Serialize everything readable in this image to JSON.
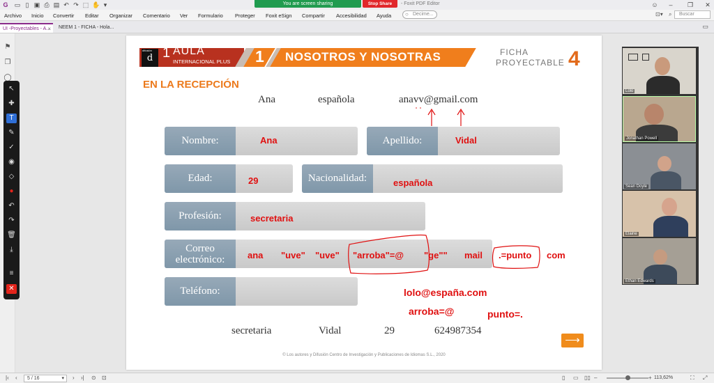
{
  "window": {
    "share_banner": "You are screen sharing",
    "stop_share": "Stop Share",
    "app_title": "- Foxit PDF Editor"
  },
  "menu": {
    "items": [
      "Archivo",
      "Inicio",
      "Convertir",
      "Editar",
      "Organizar",
      "Comentario",
      "Ver",
      "Formulario",
      "Proteger",
      "Foxit eSign",
      "Compartir",
      "Accesibilidad",
      "Ayuda"
    ],
    "help_search_placeholder": "Decime...",
    "doc_search_placeholder": "Buscar"
  },
  "tabs": [
    {
      "label": "UI -Proyectables - A...",
      "active": true
    },
    {
      "label": "NEEM 1 - FICHA - Hola...",
      "active": false
    }
  ],
  "document": {
    "logo": {
      "badge": "d",
      "number": "1",
      "title": "AULA",
      "subtitle": "INTERNACIONAL PLUS",
      "tiny": "difusión"
    },
    "unit_number": "1",
    "unit_title": "NOSOTROS Y NOSOTRAS",
    "ficha_label_1": "FICHA",
    "ficha_label_2": "PROYECTABLE",
    "ficha_number": "4",
    "section_title": "EN LA RECEPCIÓN",
    "hints_top": [
      "Ana",
      "española",
      "anavv@gmail.com"
    ],
    "hints_bottom": [
      "secretaria",
      "Vidal",
      "29",
      "624987354"
    ],
    "fields": {
      "nombre": {
        "label": "Nombre:",
        "value": "Ana"
      },
      "apellido": {
        "label": "Apellido:",
        "value": "Vidal"
      },
      "edad": {
        "label": "Edad:",
        "value": "29"
      },
      "nacionalidad": {
        "label": "Nacionalidad:",
        "value": "española"
      },
      "profesion": {
        "label": "Profesión:",
        "value": "secretaria"
      },
      "correo": {
        "label_1": "Correo",
        "label_2": "electrónico:"
      },
      "telefono": {
        "label": "Teléfono:"
      }
    },
    "annotations": {
      "correo_words": [
        "ana",
        "\"uve\"",
        "\"uve\"",
        "\"arroba\"=@",
        "\"ge\"\"",
        "mail",
        ".=punto",
        "com"
      ],
      "example_email": "lolo@españa.com",
      "arroba_rule": "arroba=@",
      "punto_rule": "punto=."
    },
    "copyright": "© Los autores y Difusión Centro de Investigación y Publicaciones de Idiomas S.L., 2020"
  },
  "participants": [
    "Lolo",
    "Jonathan Powell",
    "Sean Doyle",
    "Elaine",
    "Ethan Edwards"
  ],
  "statusbar": {
    "page_counter": "5 / 16",
    "zoom": "113,62%"
  },
  "colors": {
    "accent_orange": "#f07e1c",
    "logo_red": "#b8311f",
    "ink_red": "#e01010",
    "label_blue": "#8aa0b2",
    "share_green": "#1f9b4f"
  }
}
